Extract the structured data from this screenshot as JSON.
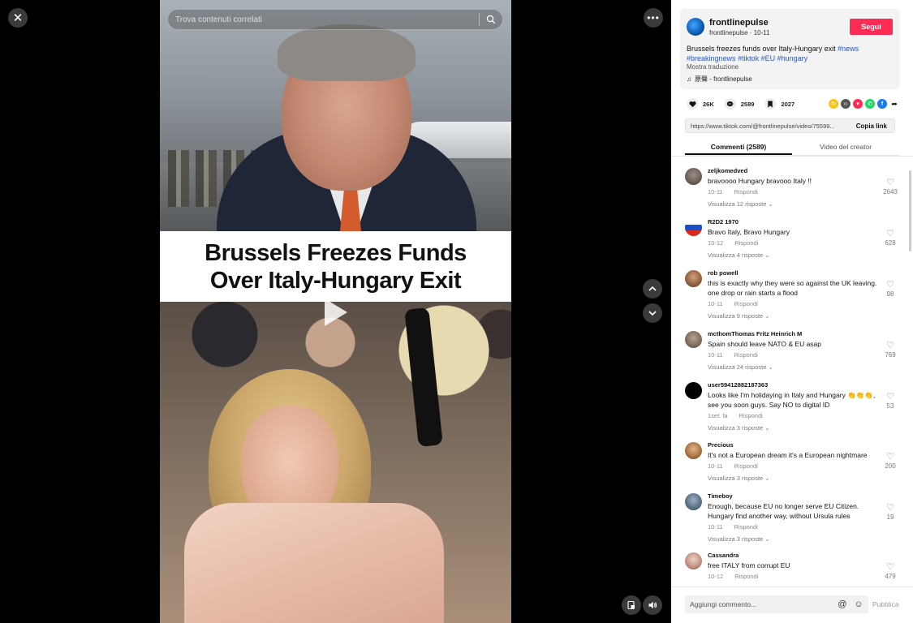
{
  "video": {
    "search_placeholder": "Trova contenuti correlati",
    "headline_line1": "Brussels Freezes Funds",
    "headline_line2": "Over Italy-Hungary Exit"
  },
  "post": {
    "author": "frontlinepulse",
    "handle_date": "frontlinepulse · 10-11",
    "follow_label": "Segui",
    "caption_text": "Brussels freezes funds over Italy-Hungary exit ",
    "hashtags": [
      "#news",
      "#breakingnews",
      "#tiktok",
      "#EU",
      "#hungary"
    ],
    "translate_label": "Mostra traduzione",
    "music": "原聲 - frontlinepulse",
    "likes": "26K",
    "comments_count": "2589",
    "saves": "2027",
    "link": "https://www.tiktok.com/@frontlinepulse/video/75599...",
    "copy_link_label": "Copia link"
  },
  "tabs": {
    "comments": "Commenti (2589)",
    "creator_videos": "Video del creator"
  },
  "comments": [
    {
      "user": "zeljkomedved",
      "text": "bravoooo Hungary bravooo Italy !!",
      "date": "10-11",
      "reply": "Rispondi",
      "replies": "Visualizza 12 risposte",
      "likes": "2643"
    },
    {
      "user": "R2D2 1970",
      "text": "Bravo Italy, Bravo Hungary",
      "date": "10-12",
      "reply": "Rispondi",
      "replies": "Visualizza 4 risposte",
      "likes": "628"
    },
    {
      "user": "rob powell",
      "text": "this is exactly why they were so against the UK leaving. one drop or rain starts a flood",
      "date": "10-11",
      "reply": "Rispondi",
      "replies": "Visualizza 9 risposte",
      "likes": "98"
    },
    {
      "user": "mcthomThomas Fritz Heinrich M",
      "text": "Spain should leave NATO & EU asap",
      "date": "10-11",
      "reply": "Rispondi",
      "replies": "Visualizza 24 risposte",
      "likes": "769"
    },
    {
      "user": "user59412882187363",
      "text": "Looks like I'm holidaying in Italy and Hungary 👏👏👏, see you soon guys. Say NO to digital ID",
      "date": "1set. fa",
      "reply": "Rispondi",
      "replies": "Visualizza 3 risposte",
      "likes": "53"
    },
    {
      "user": "Precious",
      "text": "It's not a European dream it's a European nightmare",
      "date": "10-11",
      "reply": "Rispondi",
      "replies": "Visualizza 3 risposte",
      "likes": "200"
    },
    {
      "user": "Timeboy",
      "text": "Enough, because EU no longer serve EU Citizen. Hungary find another way, without Ursula rules",
      "date": "10-11",
      "reply": "Rispondi",
      "replies": "Visualizza 3 risposte",
      "likes": "19"
    },
    {
      "user": "Cassandra",
      "text": "free ITALY from corrupt EU",
      "date": "10-12",
      "reply": "Rispondi",
      "replies": "",
      "likes": "479"
    }
  ],
  "comment_box": {
    "placeholder": "Aggiungi commento...",
    "publish_label": "Pubblica"
  },
  "colors": {
    "follow": "#fe2c55",
    "hashtag": "#2b58c6"
  }
}
